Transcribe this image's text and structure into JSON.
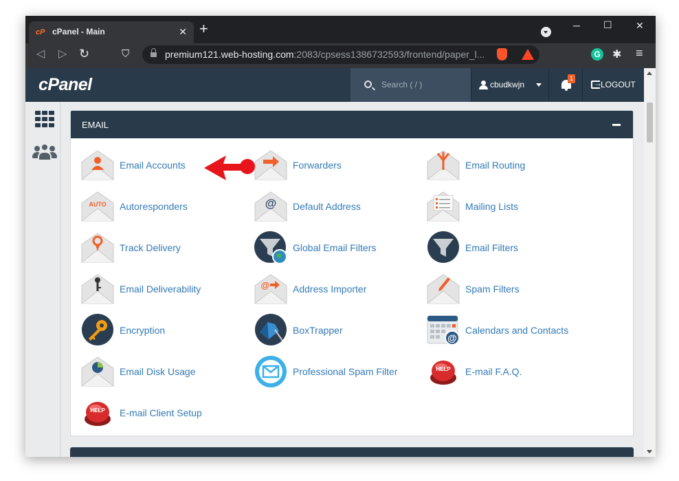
{
  "browser": {
    "tab_title": "cPanel - Main",
    "tab_favicon": "cP",
    "url_host": "premium121.web-hosting.com",
    "url_rest": ":2083/cpsess1386732593/frontend/paper_l...",
    "close_glyph": "✕",
    "new_tab_glyph": "+",
    "minimize_glyph": "─",
    "maximize_glyph": "☐",
    "window_close_glyph": "✕",
    "back_glyph": "◁",
    "forward_glyph": "▷",
    "reload_glyph": "↻",
    "bookmark_glyph": "⛉",
    "extensions_glyph": "✱",
    "menu_glyph": "≡",
    "grammarly": "G"
  },
  "header": {
    "logo": "cPanel",
    "search_placeholder": "Search ( / )",
    "username": "cbudkwjn",
    "notifications": "1",
    "logout": "LOGOUT"
  },
  "email_section": {
    "title": "EMAIL",
    "items": [
      {
        "label": "Email Accounts",
        "icon": "email-accounts-icon"
      },
      {
        "label": "Forwarders",
        "icon": "forwarders-icon"
      },
      {
        "label": "Email Routing",
        "icon": "email-routing-icon"
      },
      {
        "label": "Autoresponders",
        "icon": "autoresponders-icon"
      },
      {
        "label": "Default Address",
        "icon": "default-address-icon"
      },
      {
        "label": "Mailing Lists",
        "icon": "mailing-lists-icon"
      },
      {
        "label": "Track Delivery",
        "icon": "track-delivery-icon"
      },
      {
        "label": "Global Email Filters",
        "icon": "global-email-filters-icon"
      },
      {
        "label": "Email Filters",
        "icon": "email-filters-icon"
      },
      {
        "label": "Email Deliverability",
        "icon": "email-deliverability-icon"
      },
      {
        "label": "Address Importer",
        "icon": "address-importer-icon"
      },
      {
        "label": "Spam Filters",
        "icon": "spam-filters-icon"
      },
      {
        "label": "Encryption",
        "icon": "encryption-icon"
      },
      {
        "label": "BoxTrapper",
        "icon": "boxtrapper-icon"
      },
      {
        "label": "Calendars and Contacts",
        "icon": "calendars-contacts-icon"
      },
      {
        "label": "Email Disk Usage",
        "icon": "email-disk-usage-icon"
      },
      {
        "label": "Professional Spam Filter",
        "icon": "professional-spam-filter-icon"
      },
      {
        "label": "E-mail F.A.Q.",
        "icon": "email-faq-icon"
      },
      {
        "label": "E-mail Client Setup",
        "icon": "email-client-setup-icon"
      }
    ],
    "icon_text": {
      "auto": "AUTO",
      "at": "@",
      "help": "HELP"
    }
  },
  "colors": {
    "accent_orange": "#f0602a",
    "link_blue": "#337ab7",
    "header_navy": "#293a4a",
    "annotation_red": "#e8141c"
  }
}
